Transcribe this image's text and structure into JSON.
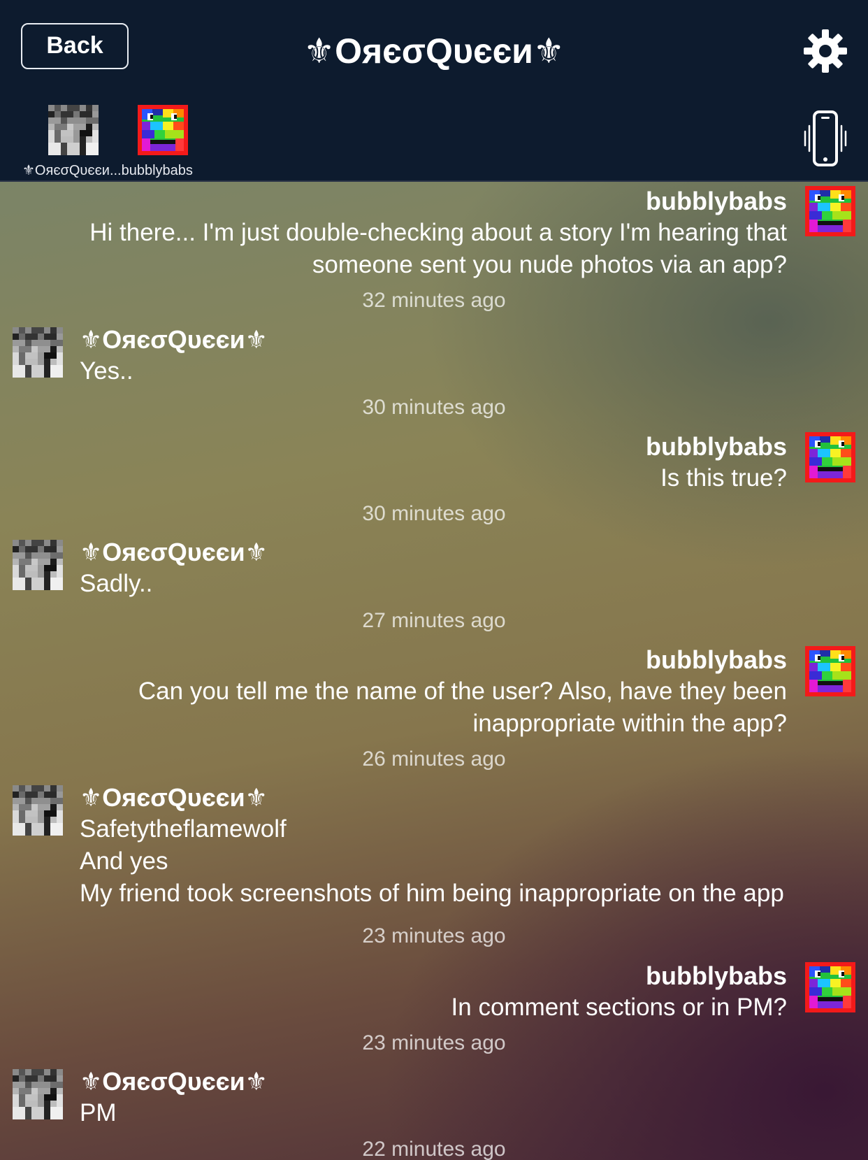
{
  "header": {
    "back_label": "Back",
    "title": "⚜ОяєσQυєєи⚜",
    "participants_label": "⚜OяєσQυєєи...bubblybabs"
  },
  "messages": [
    {
      "sender": "bubblybabs",
      "side": "right",
      "lines": [
        "Hi there... I'm just double-checking about a story I'm hearing that",
        "someone sent you nude photos via an app?"
      ],
      "time": "32 minutes ago"
    },
    {
      "sender": "⚜ОяєσQυєєи⚜",
      "side": "left",
      "lines": [
        "Yes.."
      ],
      "time": "30 minutes ago"
    },
    {
      "sender": "bubblybabs",
      "side": "right",
      "lines": [
        "Is this true?"
      ],
      "time": "30 minutes ago"
    },
    {
      "sender": "⚜ОяєσQυєєи⚜",
      "side": "left",
      "lines": [
        "Sadly.."
      ],
      "time": "27 minutes ago"
    },
    {
      "sender": "bubblybabs",
      "side": "right",
      "lines": [
        "Can you tell me the name of the user?  Also, have they been",
        "inappropriate within the app?"
      ],
      "time": "26 minutes ago"
    },
    {
      "sender": "⚜ОяєσQυєєи⚜",
      "side": "left",
      "lines": [
        "Safetytheflamewolf",
        "And yes",
        "My friend took screenshots of him being inappropriate on the app"
      ],
      "time": "23 minutes ago"
    },
    {
      "sender": "bubblybabs",
      "side": "right",
      "lines": [
        "In comment sections or in PM?"
      ],
      "time": "23 minutes ago"
    },
    {
      "sender": "⚜ОяєσQυєєи⚜",
      "side": "left",
      "lines": [
        "PM"
      ],
      "time": "22 minutes ago"
    }
  ],
  "icons": {
    "settings": "gear-icon",
    "vibrate": "phone-vibrate-icon",
    "avatar_oreo": "pixel-avatar-gray",
    "avatar_bubbly": "pixel-avatar-rainbow"
  }
}
